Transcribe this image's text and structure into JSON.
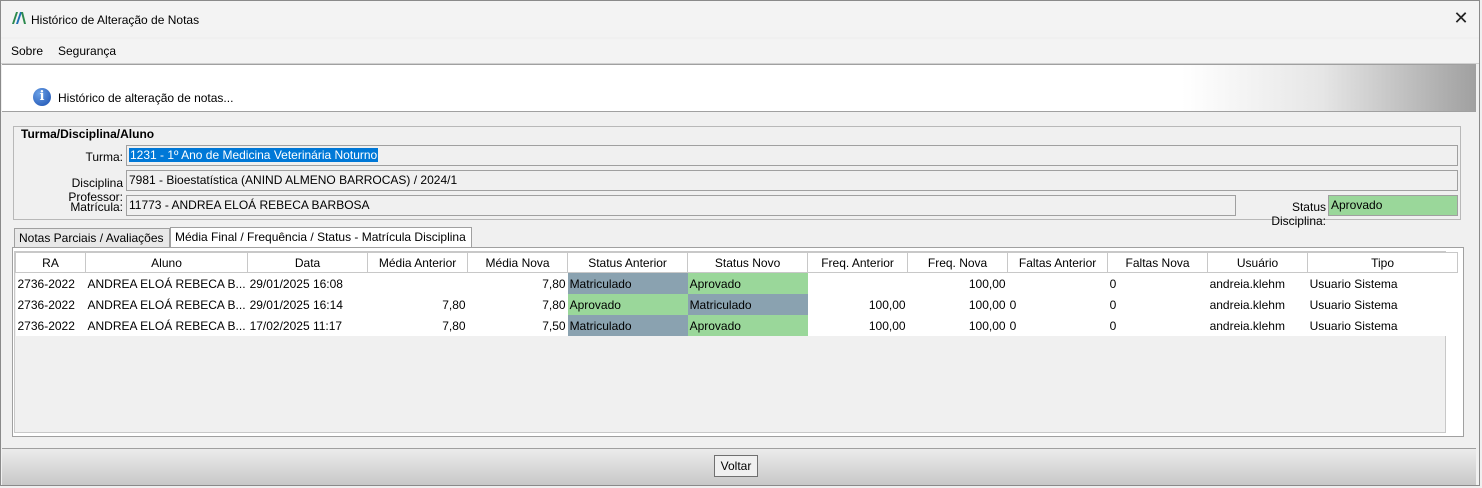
{
  "window": {
    "title": "Histórico de Alteração de Notas"
  },
  "menu": {
    "items": [
      "Sobre",
      "Segurança"
    ]
  },
  "header": {
    "text": "Histórico de alteração de notas..."
  },
  "group": {
    "legend": "Turma/Disciplina/Aluno",
    "turma_label": "Turma:",
    "turma_value": "1231 - 1º Ano de Medicina Veterinária Noturno",
    "disciplina_label": "Disciplina Professor:",
    "disciplina_value": "7981 - Bioestatística  (ANIND ALMENO BARROCAS) / 2024/1",
    "matricula_label": "Matrícula:",
    "matricula_value": "11773 - ANDREA ELOÁ REBECA BARBOSA",
    "status_label": "Status Disciplina:",
    "status_value": "Aprovado"
  },
  "tabs": [
    {
      "label": "Notas Parciais / Avaliações",
      "active": false
    },
    {
      "label": "Média Final / Frequência / Status - Matrícula Disciplina",
      "active": true
    }
  ],
  "table": {
    "columns": [
      "RA",
      "Aluno",
      "Data",
      "Média Anterior",
      "Média Nova",
      "Status Anterior",
      "Status Novo",
      "Freq. Anterior",
      "Freq. Nova",
      "Faltas Anterior",
      "Faltas Nova",
      "Usuário",
      "Tipo"
    ],
    "rows": [
      [
        "2736-2022",
        "ANDREA ELOÁ REBECA B...",
        "29/01/2025 16:08",
        "",
        "7,80",
        "Matriculado",
        "Aprovado",
        "",
        "100,00",
        "",
        "0",
        "andreia.klehm",
        "Usuario Sistema"
      ],
      [
        "2736-2022",
        "ANDREA ELOÁ REBECA B...",
        "29/01/2025 16:14",
        "7,80",
        "7,80",
        "Aprovado",
        "Matriculado",
        "100,00",
        "100,00",
        "0",
        "0",
        "andreia.klehm",
        "Usuario Sistema"
      ],
      [
        "2736-2022",
        "ANDREA ELOÁ REBECA B...",
        "17/02/2025 11:17",
        "7,80",
        "7,50",
        "Matriculado",
        "Aprovado",
        "100,00",
        "100,00",
        "0",
        "0",
        "andreia.klehm",
        "Usuario Sistema"
      ]
    ]
  },
  "footer": {
    "voltar_label": "Voltar"
  },
  "colors": {
    "approved": "#9ad79a",
    "enrolled": "#8aa2b0",
    "selection": "#0078d7"
  }
}
